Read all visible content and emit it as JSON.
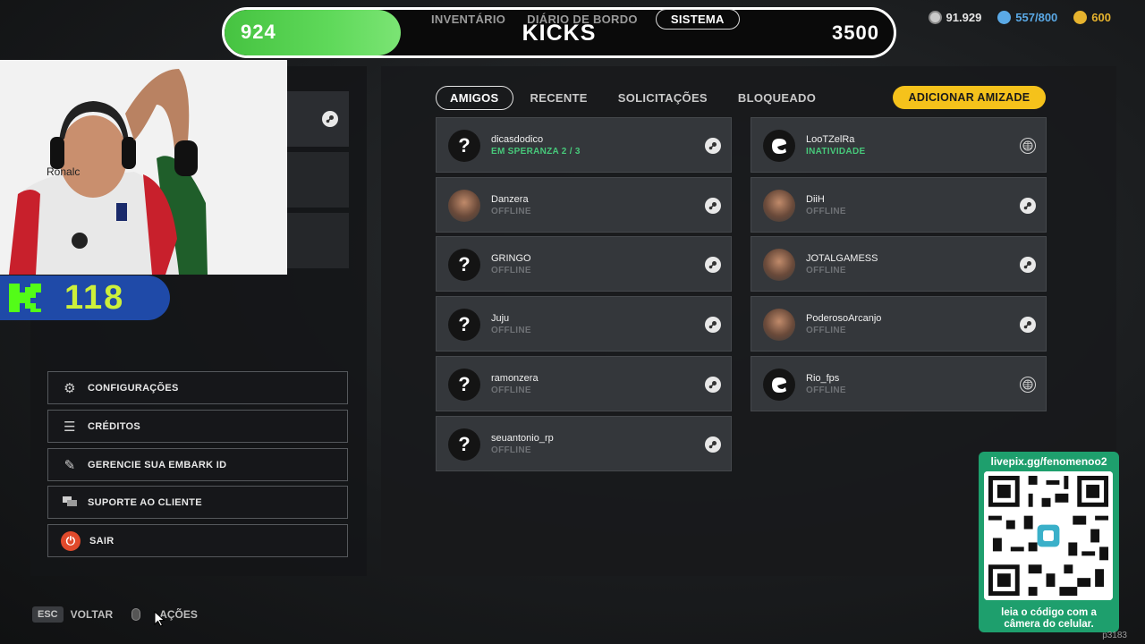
{
  "kicks_bar": {
    "current": "924",
    "label": "KICKS",
    "goal": "3500",
    "progress_fraction": 0.264
  },
  "game_tabs": [
    {
      "label": "INVENTÁRIO"
    },
    {
      "label": "DIÁRIO DE BORDO"
    },
    {
      "label": "SISTEMA"
    }
  ],
  "currencies": [
    {
      "value": "91.929",
      "icon": "multibucks-coin-icon",
      "color": "#c9c9c9"
    },
    {
      "value": "557/800",
      "icon": "vres-coin-icon",
      "color": "#5aa9e6"
    },
    {
      "value": "600",
      "icon": "gold-coin-icon",
      "color": "#e6b32e"
    }
  ],
  "webcam": {
    "name_tag": "Ronalc"
  },
  "kick_counter": {
    "value": "118",
    "logo": "kick-logo-icon"
  },
  "left_menu": [
    {
      "label": "CONFIGURAÇÕES",
      "icon": "gear-icon"
    },
    {
      "label": "CRÉDITOS",
      "icon": "list-icon"
    },
    {
      "label": "GERENCIE SUA EMBARK ID",
      "icon": "edit-icon"
    },
    {
      "label": "SUPORTE AO CLIENTE",
      "icon": "chat-icon"
    },
    {
      "label": "SAIR",
      "icon": "power-icon"
    }
  ],
  "bottom_hints": {
    "esc_key": "ESC",
    "back": "VOLTAR",
    "options": "AÇÕES"
  },
  "friend_tabs": [
    {
      "label": "AMIGOS",
      "active": true
    },
    {
      "label": "RECENTE",
      "active": false
    },
    {
      "label": "SOLICITAÇÕES",
      "active": false
    },
    {
      "label": "BLOQUEADO",
      "active": false
    }
  ],
  "add_friend_label": "ADICIONAR AMIZADE",
  "friends_left": [
    {
      "name": "dicasdodico",
      "status": "EM SPERANZA  2 / 3",
      "status_color": "green",
      "avatar": "question",
      "platform": "steam"
    },
    {
      "name": "Danzera",
      "status": "OFFLINE",
      "avatar": "photo",
      "platform": "steam"
    },
    {
      "name": "GRINGO",
      "status": "OFFLINE",
      "avatar": "question",
      "platform": "steam"
    },
    {
      "name": "Juju",
      "status": "OFFLINE",
      "avatar": "question",
      "platform": "steam"
    },
    {
      "name": "ramonzera",
      "status": "OFFLINE",
      "avatar": "question",
      "platform": "steam"
    },
    {
      "name": "seuantonio_rp",
      "status": "OFFLINE",
      "avatar": "question",
      "platform": "steam"
    }
  ],
  "friends_right": [
    {
      "name": "LooTZelRa",
      "status": "INATIVIDADE",
      "status_color": "green",
      "avatar": "embark",
      "platform": "globe"
    },
    {
      "name": "DiiH",
      "status": "OFFLINE",
      "avatar": "photo",
      "platform": "steam"
    },
    {
      "name": "JOTALGAMESS",
      "status": "OFFLINE",
      "avatar": "photo",
      "platform": "steam"
    },
    {
      "name": "PoderosoArcanjo",
      "status": "OFFLINE",
      "avatar": "photo",
      "platform": "steam"
    },
    {
      "name": "Rio_fps",
      "status": "OFFLINE",
      "avatar": "embark",
      "platform": "globe"
    }
  ],
  "qr_widget": {
    "title": "livepix.gg/fenomenoo2",
    "caption": "leia o código com a câmera do celular."
  },
  "corner_id": "p3183"
}
